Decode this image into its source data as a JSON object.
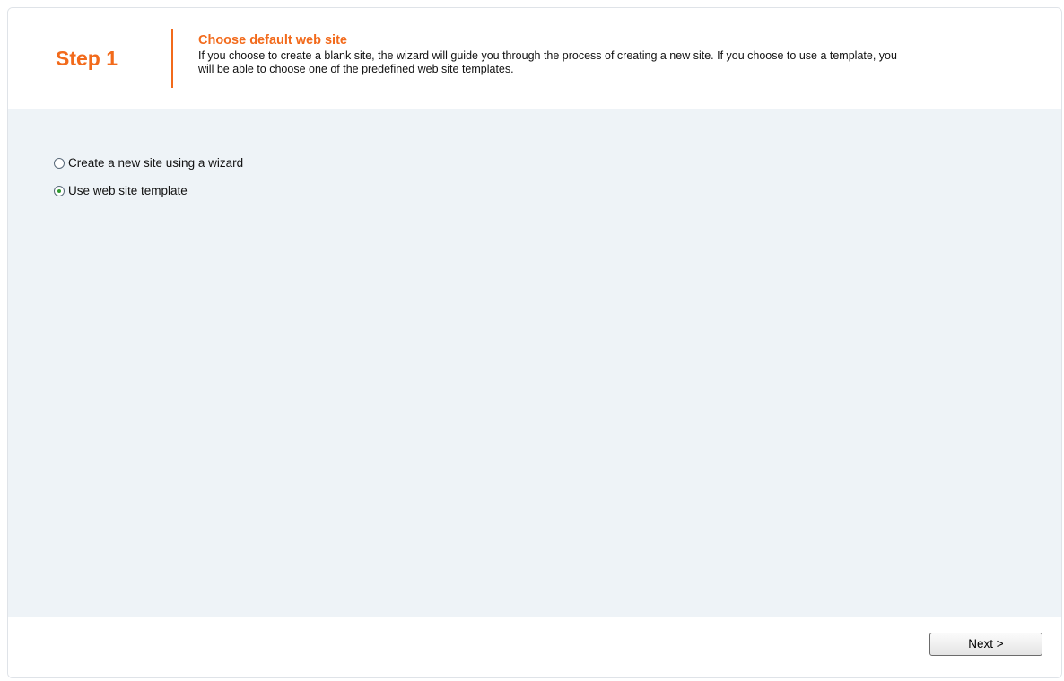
{
  "header": {
    "step": "Step 1",
    "title": "Choose default web site",
    "description": "If you choose to create a blank site, the wizard will guide you through the process of creating a new site. If you choose to use a template, you will be able to choose one of the predefined web site templates."
  },
  "options": [
    {
      "label": "Create a new site using a wizard",
      "checked": false
    },
    {
      "label": "Use web site template",
      "checked": true
    }
  ],
  "footer": {
    "next_label": "Next >"
  },
  "colors": {
    "accent": "#f26a1b",
    "content_bg": "#eef3f7",
    "radio_checked": "#2f9a2f"
  }
}
